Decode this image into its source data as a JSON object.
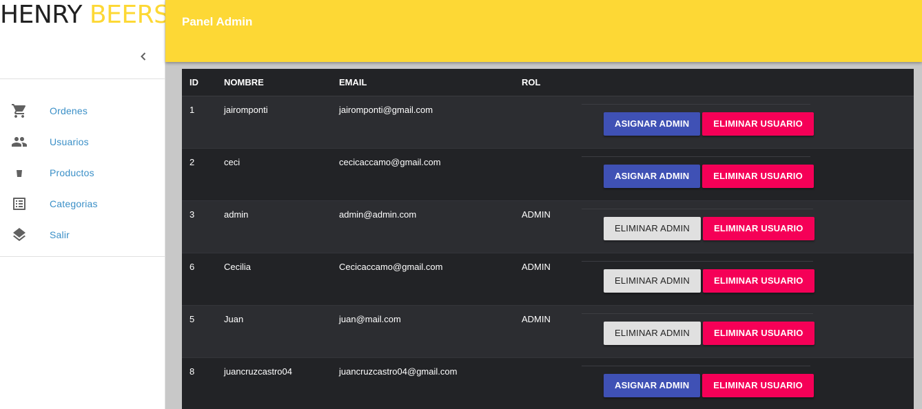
{
  "brand": {
    "part1": "HENRY",
    "part2": "BEERS"
  },
  "sidebar": {
    "collapse_icon": "chevron-left-icon",
    "items": [
      {
        "label": "Ordenes",
        "icon": "cart-icon"
      },
      {
        "label": "Usuarios",
        "icon": "people-icon"
      },
      {
        "label": "Productos",
        "icon": "glass-icon"
      },
      {
        "label": "Categorias",
        "icon": "list-icon"
      },
      {
        "label": "Salir",
        "icon": "layers-icon"
      }
    ]
  },
  "header": {
    "title": "Panel Admin"
  },
  "colors": {
    "header": "#fdd835",
    "brand_accent": "#fdd835",
    "assign": "#3f51b5",
    "delete": "#f50057",
    "remove_admin": "#e0e0e0",
    "table_bg": "#222326",
    "nav_text": "#3a8fc7"
  },
  "table": {
    "columns": {
      "id": "ID",
      "name": "NOMBRE",
      "email": "EMAIL",
      "rol": "ROL"
    },
    "rows": [
      {
        "id": "1",
        "name": "jairomponti",
        "email": "jairomponti@gmail.com",
        "rol": "",
        "admin_action": "ASIGNAR ADMIN",
        "delete_action": "ELIMINAR USUARIO",
        "is_admin": false
      },
      {
        "id": "2",
        "name": "ceci",
        "email": "cecicaccamo@gmail.com",
        "rol": "",
        "admin_action": "ASIGNAR ADMIN",
        "delete_action": "ELIMINAR USUARIO",
        "is_admin": false
      },
      {
        "id": "3",
        "name": "admin",
        "email": "admin@admin.com",
        "rol": "ADMIN",
        "admin_action": "ELIMINAR ADMIN",
        "delete_action": "ELIMINAR USUARIO",
        "is_admin": true
      },
      {
        "id": "6",
        "name": "Cecilia",
        "email": "Cecicaccamo@gmail.com",
        "rol": "ADMIN",
        "admin_action": "ELIMINAR ADMIN",
        "delete_action": "ELIMINAR USUARIO",
        "is_admin": true
      },
      {
        "id": "5",
        "name": "Juan",
        "email": "juan@mail.com",
        "rol": "ADMIN",
        "admin_action": "ELIMINAR ADMIN",
        "delete_action": "ELIMINAR USUARIO",
        "is_admin": true
      },
      {
        "id": "8",
        "name": "juancruzcastro04",
        "email": "juancruzcastro04@gmail.com",
        "rol": "",
        "admin_action": "ASIGNAR ADMIN",
        "delete_action": "ELIMINAR USUARIO",
        "is_admin": false
      }
    ]
  }
}
